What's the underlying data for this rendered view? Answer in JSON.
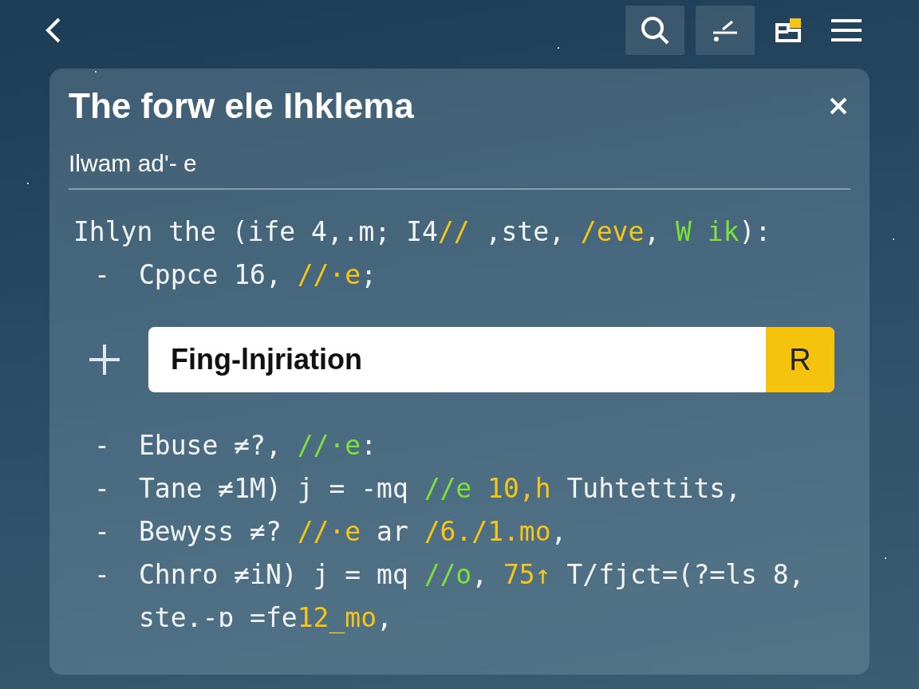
{
  "toolbar": {
    "buttons": [
      {
        "kind": "back",
        "boxed": false
      },
      {
        "kind": "search",
        "boxed": true
      },
      {
        "kind": "edit",
        "boxed": true
      },
      {
        "kind": "layout",
        "boxed": false
      },
      {
        "kind": "menu",
        "boxed": false
      }
    ]
  },
  "card": {
    "title": "The forw ele Ihklema",
    "subtitle": "Ilwam ad'- e",
    "intro": [
      {
        "text": "Ihlyn the (ife 4,.m; I4",
        "color": "#f2f5f7"
      },
      {
        "text": "//",
        "color": "#f5c518"
      },
      {
        "text": " ,ste, ",
        "color": "#f2f5f7"
      },
      {
        "text": "/eve",
        "color": "#f5c518"
      },
      {
        "text": ", ",
        "color": "#f2f5f7"
      },
      {
        "text": "W ik",
        "color": "#7ee03a"
      },
      {
        "text": "):",
        "color": "#f2f5f7"
      }
    ],
    "top_items": [
      {
        "bullet": "-",
        "segments": [
          {
            "text": "Cppce 16, ",
            "color": "#f2f5f7"
          },
          {
            "text": "//·e",
            "color": "#f5c518"
          },
          {
            "text": ";",
            "color": "#f2f5f7"
          }
        ]
      }
    ],
    "entry": {
      "value": "Fing-lnjriation",
      "button": "R"
    },
    "items": [
      {
        "bullet": "-",
        "segments": [
          {
            "text": "Ebuse ≠?, ",
            "color": "#f2f5f7"
          },
          {
            "text": "//·e",
            "color": "#7ee03a"
          },
          {
            "text": ":",
            "color": "#f2f5f7"
          }
        ]
      },
      {
        "bullet": "-",
        "segments": [
          {
            "text": "Tane ≠1M) j = -mq ",
            "color": "#f2f5f7"
          },
          {
            "text": "//e",
            "color": "#7ee03a"
          },
          {
            "text": " 10,h",
            "color": "#f5c518"
          },
          {
            "text": " Tuhtettits,",
            "color": "#f2f5f7"
          }
        ]
      },
      {
        "bullet": "-",
        "segments": [
          {
            "text": "Bewyss ≠? ",
            "color": "#f2f5f7"
          },
          {
            "text": "//·e",
            "color": "#f5c518"
          },
          {
            "text": " ar ",
            "color": "#f2f5f7"
          },
          {
            "text": "/6./1.mo",
            "color": "#f5c518"
          },
          {
            "text": ",",
            "color": "#f2f5f7"
          }
        ]
      },
      {
        "bullet": "-",
        "segments": [
          {
            "text": "Chnro ≠iN) j = mq ",
            "color": "#f2f5f7"
          },
          {
            "text": "//o",
            "color": "#7ee03a"
          },
          {
            "text": ", ",
            "color": "#f2f5f7"
          },
          {
            "text": "75↑",
            "color": "#f5c518"
          },
          {
            "text": " T/fjct=(?=ls 8, ste.-ɒ =fe",
            "color": "#f2f5f7"
          },
          {
            "text": "12_mo",
            "color": "#f5c518"
          },
          {
            "text": ",",
            "color": "#f2f5f7"
          }
        ]
      }
    ]
  }
}
